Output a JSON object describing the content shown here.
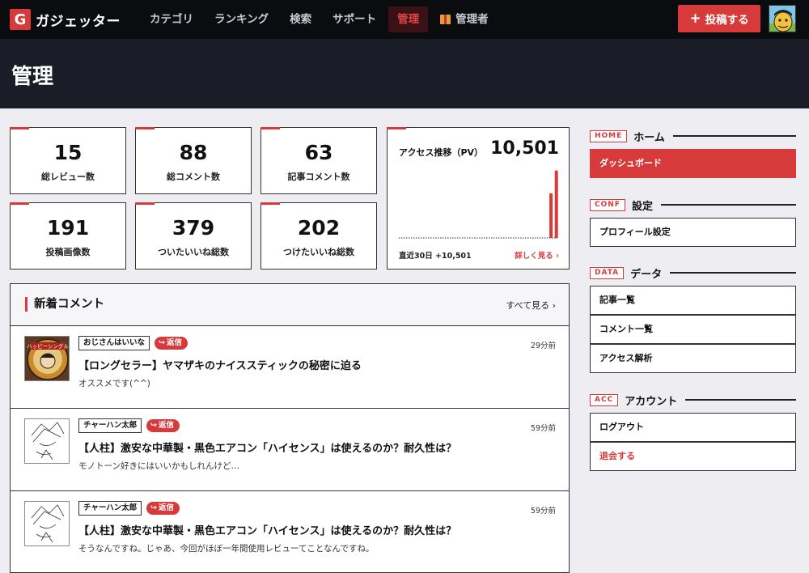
{
  "brand": {
    "logo_letter": "G",
    "name": "ガジェッター"
  },
  "nav": {
    "items": [
      "カテゴリ",
      "ランキング",
      "検索",
      "サポート",
      "管理"
    ],
    "admin_label": "管理者",
    "post_label": "投稿する"
  },
  "page": {
    "title": "管理"
  },
  "stats": [
    {
      "value": "15",
      "label": "総レビュー数"
    },
    {
      "value": "88",
      "label": "総コメント数"
    },
    {
      "value": "63",
      "label": "記事コメント数"
    },
    {
      "value": "191",
      "label": "投稿画像数"
    },
    {
      "value": "379",
      "label": "ついたいいね総数"
    },
    {
      "value": "202",
      "label": "つけたいいね総数"
    }
  ],
  "access": {
    "title": "アクセス推移（PV）",
    "value": "10,501",
    "footer": "直近30日 +10,501",
    "more": "詳しく見る ›"
  },
  "chart_data": {
    "type": "bar",
    "title": "アクセス推移（PV）",
    "xlabel": "",
    "ylabel": "",
    "days": 30,
    "values": [
      0,
      0,
      0,
      0,
      0,
      0,
      0,
      0,
      0,
      0,
      0,
      0,
      0,
      0,
      0,
      0,
      0,
      0,
      0,
      0,
      0,
      0,
      0,
      0,
      0,
      0,
      0,
      0,
      6300,
      9500
    ],
    "ylim": [
      0,
      9800
    ],
    "grid": false,
    "legend": "none"
  },
  "comments": {
    "title": "新着コメント",
    "see_all": "すべて見る ›",
    "reply_label": "返信",
    "items": [
      {
        "user": "おじさんはいいな",
        "time": "29分前",
        "article": "【ロングセラー】ヤマザキのナイススティックの秘密に迫る",
        "excerpt": "オススメです(^^)",
        "thumb_text": "ハッピーシングル"
      },
      {
        "user": "チャーハン太郎",
        "time": "59分前",
        "article": "【人柱】激安な中華製・黒色エアコン「ハイセンス」は使えるのか？耐久性は？",
        "excerpt": "モノトーン好きにはいいかもしれんけど…"
      },
      {
        "user": "チャーハン太郎",
        "time": "59分前",
        "article": "【人柱】激安な中華製・黒色エアコン「ハイセンス」は使えるのか？耐久性は？",
        "excerpt": "そうなんですね。じゃあ、今回がほぼ一年間使用レビューてことなんですね。"
      }
    ]
  },
  "sidebar": {
    "sections": [
      {
        "tag": "HOME",
        "label": "ホーム",
        "items": [
          "ダッシュボード"
        ]
      },
      {
        "tag": "CONF",
        "label": "設定",
        "items": [
          "プロフィール設定"
        ]
      },
      {
        "tag": "DATA",
        "label": "データ",
        "items": [
          "記事一覧",
          "コメント一覧",
          "アクセス解析"
        ]
      },
      {
        "tag": "ACC",
        "label": "アカウント",
        "items": [
          "ログアウト",
          "退会する"
        ]
      }
    ]
  },
  "colors": {
    "accent": "#d63a3a",
    "nav_bg": "#0b0c0f",
    "title_bg": "#1a1d27",
    "page_bg": "#eeeef2"
  }
}
